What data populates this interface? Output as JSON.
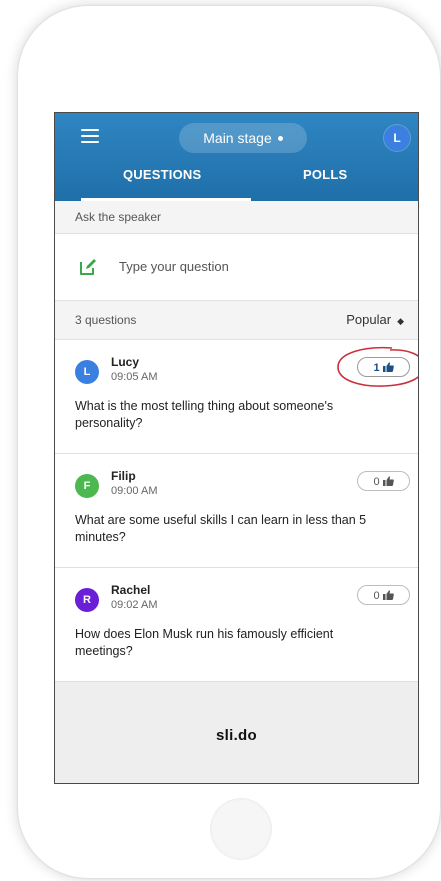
{
  "header": {
    "stage_label": "Main stage",
    "user_initial": "L",
    "tabs": [
      {
        "label": "QUESTIONS",
        "active": true
      },
      {
        "label": "POLLS",
        "active": false
      }
    ]
  },
  "ask": {
    "label": "Ask the speaker",
    "placeholder": "Type your question"
  },
  "list": {
    "count_label": "3 questions",
    "sort_label": "Popular"
  },
  "questions": [
    {
      "initial": "L",
      "name": "Lucy",
      "time": "09:05 AM",
      "likes": "1",
      "text": "What is the most telling thing about someone's personality?",
      "avatar_color": "#3b7fe0"
    },
    {
      "initial": "F",
      "name": "Filip",
      "time": "09:00 AM",
      "likes": "0",
      "text": "What are some useful skills I can learn in less than 5 minutes?",
      "avatar_color": "#4cb84f"
    },
    {
      "initial": "R",
      "name": "Rachel",
      "time": "09:02 AM",
      "likes": "0",
      "text": "How does Elon Musk run his famously efficient meetings?",
      "avatar_color": "#6a1fd6"
    }
  ],
  "brand": {
    "logo": "sli.do"
  },
  "colors": {
    "header": "#1f6fa9",
    "highlight_ring": "#c9303a",
    "compose_icon": "#3aa84a"
  }
}
